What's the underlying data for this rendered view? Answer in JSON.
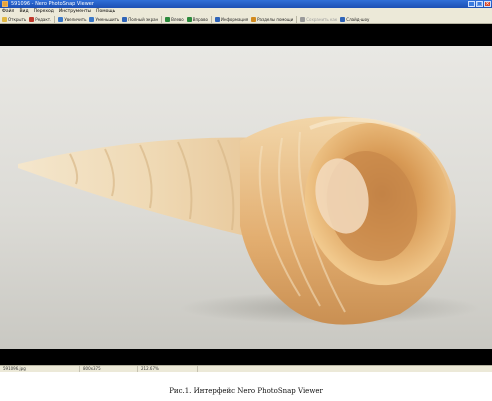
{
  "window": {
    "title": "591096 - Nero PhotoSnap Viewer",
    "buttons": [
      "_",
      "□",
      "×"
    ]
  },
  "menu": [
    "Файл",
    "Вид",
    "Переход",
    "Инструменты",
    "Помощь"
  ],
  "toolbar": [
    {
      "icon": "open-folder-icon",
      "label": "Открыть",
      "color": "#e0b640",
      "enabled": true
    },
    {
      "icon": "edit-icon",
      "label": "Редакт.",
      "color": "#c0392b",
      "enabled": true
    },
    {
      "icon": "zoom-in-icon",
      "label": "Увеличить",
      "color": "#3a78c8",
      "enabled": true
    },
    {
      "icon": "zoom-out-icon",
      "label": "Уменьшить",
      "color": "#3a78c8",
      "enabled": true
    },
    {
      "icon": "fullscreen-icon",
      "label": "Полный экран",
      "color": "#2f64b8",
      "enabled": true
    },
    {
      "icon": "back-icon",
      "label": "Влево",
      "color": "#2c8a3c",
      "enabled": true
    },
    {
      "icon": "forward-icon",
      "label": "Вправо",
      "color": "#2c8a3c",
      "enabled": true
    },
    {
      "icon": "info-icon",
      "label": "Информация",
      "color": "#2f64b8",
      "enabled": true
    },
    {
      "icon": "help-icon",
      "label": "Разделы помощи",
      "color": "#d28a1e",
      "enabled": true
    },
    {
      "icon": "save-icon",
      "label": "Сохранить как",
      "color": "#9a9a9a",
      "enabled": false
    },
    {
      "icon": "slideshow-icon",
      "label": "Слайд-шоу",
      "color": "#2f64b8",
      "enabled": true
    }
  ],
  "status": {
    "filename": "591096.jpg",
    "dimensions": "800x375",
    "zoom": "212.67%"
  },
  "caption": "Рис.1.  Интерфейс Nero PhotoSnap Viewer"
}
